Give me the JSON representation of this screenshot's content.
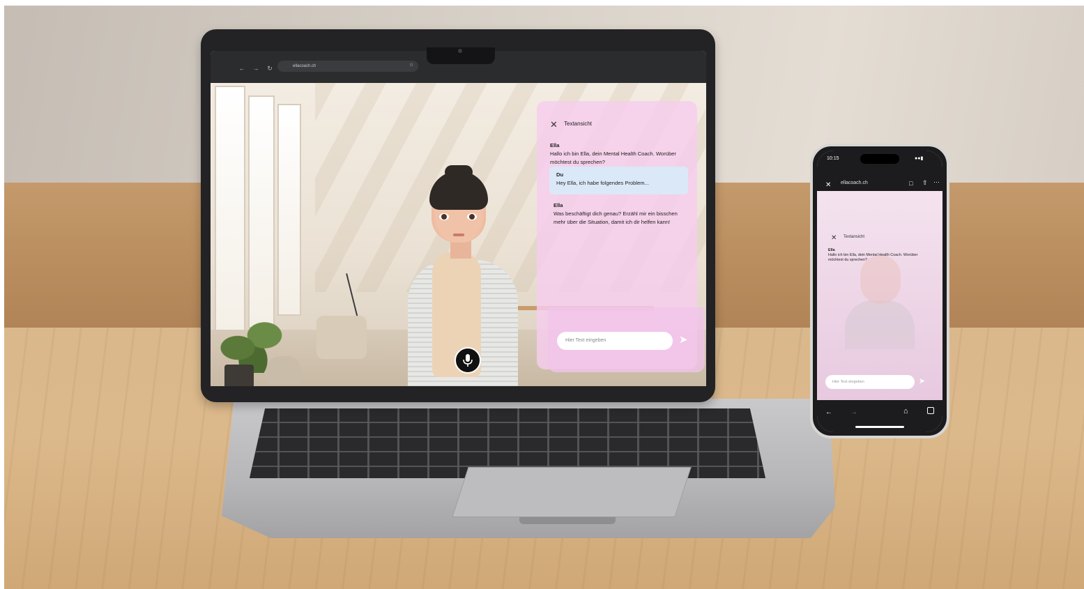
{
  "laptop": {
    "browser": {
      "url": "ellacoach.ch",
      "back_icon": "arrow-left-icon",
      "forward_icon": "arrow-right-icon",
      "reload_icon": "reload-icon"
    },
    "panel": {
      "title": "Textansicht",
      "messages": [
        {
          "sender": "Ella",
          "text": "Hallo ich bin Ella, dein Mental Health Coach. Worüber möchtest du sprechen?"
        },
        {
          "sender": "Du",
          "text": "Hey Ella, ich habe folgendes Problem..."
        },
        {
          "sender": "Ella",
          "text": "Was beschäftigt dich genau? Erzähl mir ein bisschen mehr über die Situation, damit ich dir helfen kann!"
        }
      ],
      "input_placeholder": "Hier Text eingeben"
    },
    "mic_icon": "microphone-icon"
  },
  "phone": {
    "status_time": "10:15",
    "url": "ellacoach.ch",
    "panel": {
      "title": "Textansicht",
      "message_sender": "Ella",
      "message_text": "Hallo ich bin Ella, dein Mental Health Coach. Worüber möchtest du sprechen?"
    },
    "input_placeholder": "Hier Text eingeben"
  },
  "colors": {
    "panel_pink": "#f6cdee",
    "user_bubble": "#dbe8f7",
    "browser_chrome": "#2b2c2e"
  }
}
